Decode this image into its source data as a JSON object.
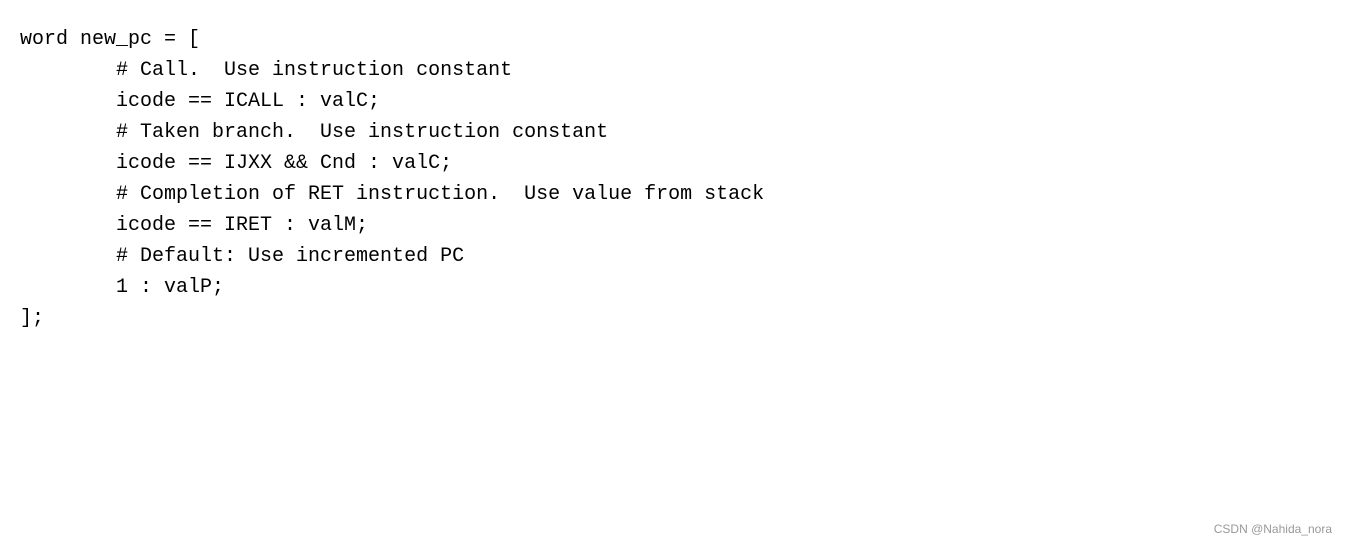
{
  "code": {
    "lines": [
      {
        "id": "line1",
        "text": "word new_pc = ["
      },
      {
        "id": "line2",
        "text": "        # Call.  Use instruction constant"
      },
      {
        "id": "line3",
        "text": "        icode == ICALL : valC;"
      },
      {
        "id": "line4",
        "text": "        # Taken branch.  Use instruction constant"
      },
      {
        "id": "line5",
        "text": "        icode == IJXX && Cnd : valC;"
      },
      {
        "id": "line6",
        "text": "        # Completion of RET instruction.  Use value from stack"
      },
      {
        "id": "line7",
        "text": "        icode == IRET : valM;"
      },
      {
        "id": "line8",
        "text": "        # Default: Use incremented PC"
      },
      {
        "id": "line9",
        "text": "        1 : valP;"
      },
      {
        "id": "line10",
        "text": "];"
      }
    ]
  },
  "watermark": {
    "text": "CSDN @Nahida_nora"
  }
}
